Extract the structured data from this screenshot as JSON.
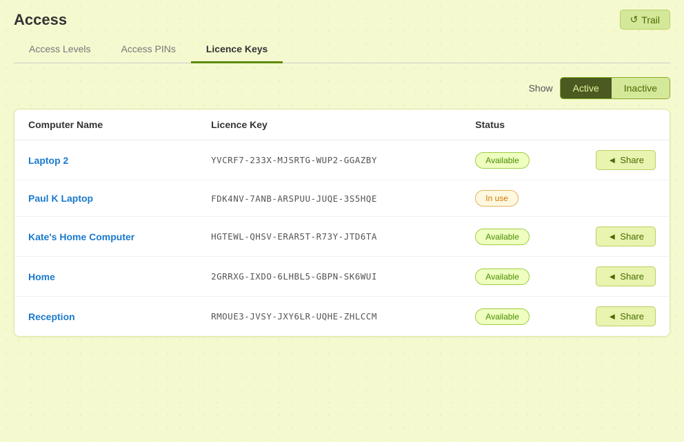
{
  "header": {
    "title": "Access",
    "trail_button": "Trail",
    "trail_icon": "↺"
  },
  "tabs": [
    {
      "id": "access-levels",
      "label": "Access Levels",
      "active": false
    },
    {
      "id": "access-pins",
      "label": "Access PINs",
      "active": false
    },
    {
      "id": "licence-keys",
      "label": "Licence Keys",
      "active": true
    }
  ],
  "show": {
    "label": "Show",
    "active_label": "Active",
    "inactive_label": "Inactive",
    "selected": "active"
  },
  "table": {
    "columns": [
      {
        "id": "computer-name",
        "label": "Computer Name"
      },
      {
        "id": "licence-key",
        "label": "Licence Key"
      },
      {
        "id": "status",
        "label": "Status"
      },
      {
        "id": "actions",
        "label": ""
      }
    ],
    "rows": [
      {
        "id": 1,
        "computer_name": "Laptop 2",
        "licence_key": "YVCRF7-233X-MJSRTG-WUP2-GGAZBY",
        "status": "Available",
        "status_type": "available",
        "has_share": true,
        "share_label": "Share"
      },
      {
        "id": 2,
        "computer_name": "Paul K Laptop",
        "licence_key": "FDK4NV-7ANB-ARSPUU-JUQE-3S5HQE",
        "status": "In use",
        "status_type": "inuse",
        "has_share": false,
        "share_label": ""
      },
      {
        "id": 3,
        "computer_name": "Kate's Home Computer",
        "licence_key": "HGTEWL-QHSV-ERAR5T-R73Y-JTD6TA",
        "status": "Available",
        "status_type": "available",
        "has_share": true,
        "share_label": "Share"
      },
      {
        "id": 4,
        "computer_name": "Home",
        "licence_key": "2GRRXG-IXDO-6LHBL5-GBPN-SK6WUI",
        "status": "Available",
        "status_type": "available",
        "has_share": true,
        "share_label": "Share"
      },
      {
        "id": 5,
        "computer_name": "Reception",
        "licence_key": "RMOUE3-JVSY-JXY6LR-UQHE-ZHLCCM",
        "status": "Available",
        "status_type": "available",
        "has_share": true,
        "share_label": "Share"
      }
    ]
  }
}
